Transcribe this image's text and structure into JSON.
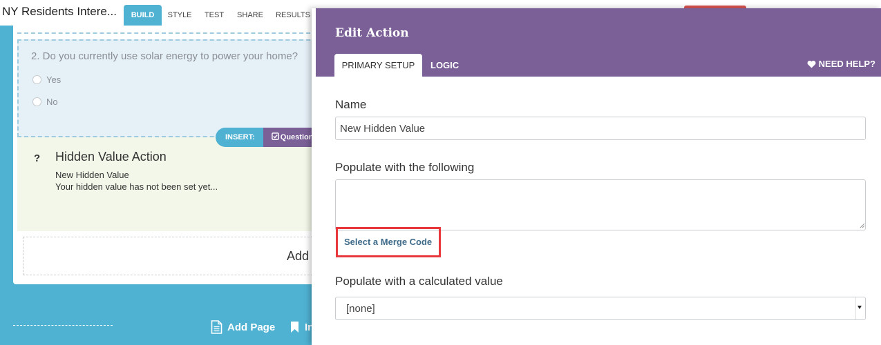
{
  "header": {
    "app_title": "NY Residents Intere...",
    "tabs": [
      {
        "label": "BUILD",
        "active": true
      },
      {
        "label": "STYLE",
        "active": false
      },
      {
        "label": "TEST",
        "active": false
      },
      {
        "label": "SHARE",
        "active": false
      },
      {
        "label": "RESULTS",
        "active": false
      }
    ]
  },
  "builder": {
    "question": {
      "text": "2. Do you currently use solar energy to power your home?",
      "options": [
        "Yes",
        "No"
      ]
    },
    "insert": {
      "label": "INSERT:",
      "question_button": "Question"
    },
    "hidden_value_action": {
      "icon": "question-mark",
      "title": "Hidden Value Action",
      "name": "New Hidden Value",
      "status": "Your hidden value has not been set yet..."
    },
    "add_block_text": "Add"
  },
  "footer": {
    "add_page_label": "Add Page",
    "bookmark_label": "In"
  },
  "modal": {
    "title": "Edit Action",
    "tabs": [
      {
        "label": "PRIMARY SETUP",
        "active": true
      },
      {
        "label": "LOGIC",
        "active": false
      }
    ],
    "need_help_label": "NEED HELP?",
    "name_label": "Name",
    "name_value": "New Hidden Value",
    "populate_label": "Populate with the following",
    "populate_value": "",
    "merge_code_link": "Select a Merge Code",
    "calc_label": "Populate with a calculated value",
    "calc_selected": "[none]"
  },
  "colors": {
    "teal": "#4fb2d3",
    "purple": "#7b5f97",
    "highlight_red": "#e8383c",
    "action_bg": "#f3f7e9",
    "question_bg": "#e6f0f7"
  }
}
